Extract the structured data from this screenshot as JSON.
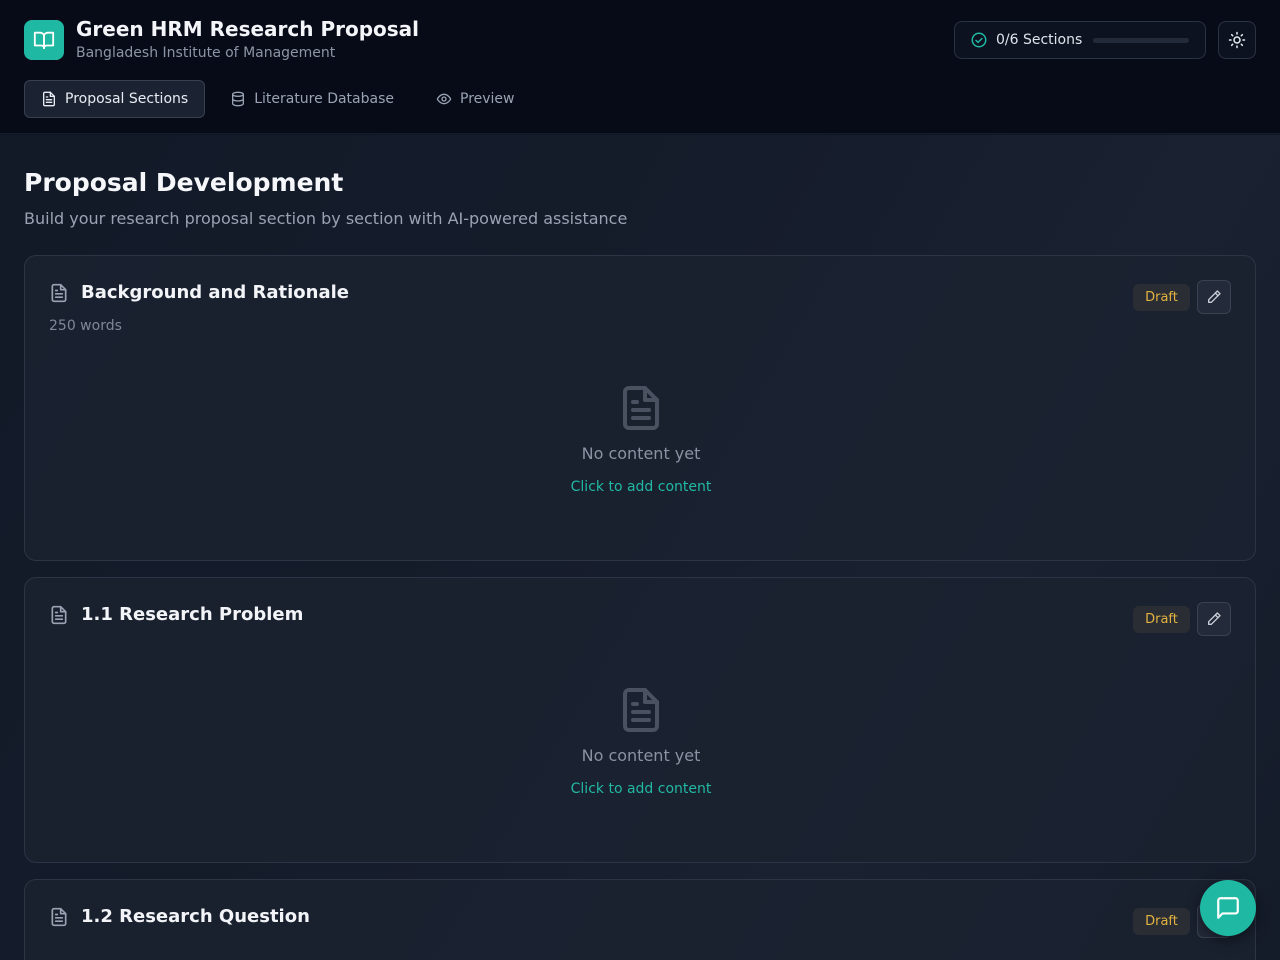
{
  "header": {
    "title": "Green HRM Research Proposal",
    "subtitle": "Bangladesh Institute of Management",
    "progress_label": "0/6 Sections",
    "progress_fraction": 0
  },
  "tabs": [
    {
      "label": "Proposal Sections",
      "icon": "document-icon",
      "active": true
    },
    {
      "label": "Literature Database",
      "icon": "database-icon",
      "active": false
    },
    {
      "label": "Preview",
      "icon": "eye-icon",
      "active": false
    }
  ],
  "main": {
    "title": "Proposal Development",
    "subtitle": "Build your research proposal section by section with AI-powered assistance"
  },
  "sections": [
    {
      "title": "Background and Rationale",
      "words": "250 words",
      "status": "Draft",
      "empty_text": "No content yet",
      "add_link": "Click to add content"
    },
    {
      "title": "1.1 Research Problem",
      "words": "",
      "status": "Draft",
      "empty_text": "No content yet",
      "add_link": "Click to add content"
    },
    {
      "title": "1.2 Research Question",
      "words": "",
      "status": "Draft",
      "empty_text": "",
      "add_link": ""
    }
  ],
  "colors": {
    "accent": "#1fb8a2",
    "draft_badge": "#e3b341",
    "background": "#0f1522"
  }
}
